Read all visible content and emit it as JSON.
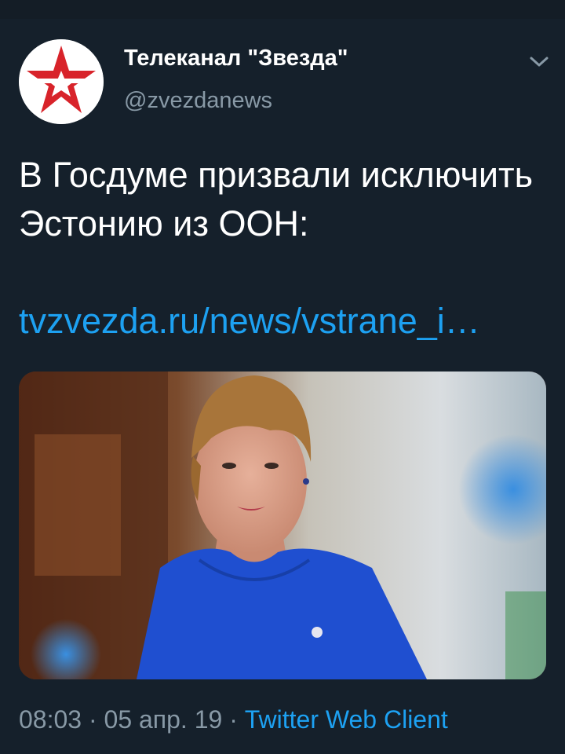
{
  "tweet": {
    "author_name": "Телеканал \"Звезда\"",
    "author_handle": "@zvezdanews",
    "text": "В Госдуме призвали исключить Эстонию из ООН:",
    "link": "tvzvezda.ru/news/vstrane_i…",
    "time": "08:03",
    "separator": "·",
    "date": "05 апр. 19",
    "client": "Twitter Web Client"
  },
  "icons": {
    "avatar": "red-star-logo-icon",
    "menu": "chevron-down-icon"
  },
  "colors": {
    "background": "#15202b",
    "accent": "#1da1f2",
    "muted": "#8899a6"
  }
}
